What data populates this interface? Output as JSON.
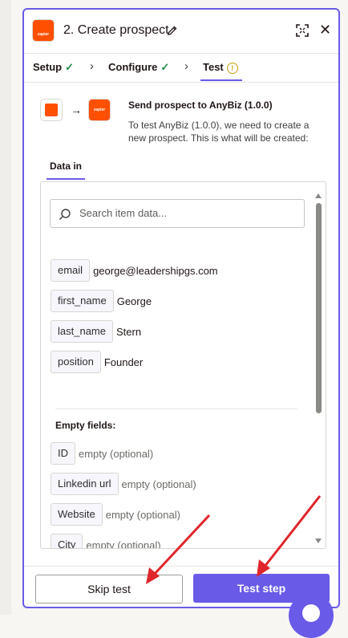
{
  "header": {
    "title": "2. Create prospect",
    "app_logo_text": "zapier"
  },
  "tabs": [
    {
      "label": "Setup",
      "status": "complete"
    },
    {
      "label": "Configure",
      "status": "complete"
    },
    {
      "label": "Test",
      "status": "warning",
      "active": true
    }
  ],
  "summary": {
    "title": "Send prospect to AnyBiz (1.0.0)",
    "description": "To test AnyBiz (1.0.0), we need to create a new prospect. This is what will be created:"
  },
  "data_in": {
    "tab_label": "Data in",
    "search_placeholder": "Search item data...",
    "fields": [
      {
        "key": "email",
        "value": "george@leadershipgs.com"
      },
      {
        "key": "first_name",
        "value": "George"
      },
      {
        "key": "last_name",
        "value": "Stern"
      },
      {
        "key": "position",
        "value": "Founder"
      }
    ],
    "empty_heading": "Empty fields:",
    "empty_fields": [
      {
        "key": "ID",
        "value": "empty (optional)"
      },
      {
        "key": "Linkedin url",
        "value": "empty (optional)"
      },
      {
        "key": "Website",
        "value": "empty (optional)"
      },
      {
        "key": "City",
        "value": "empty (optional)"
      }
    ]
  },
  "footer": {
    "skip_label": "Skip test",
    "test_label": "Test step"
  },
  "colors": {
    "accent": "#695be8",
    "brand": "#ff4f00",
    "success": "#1e8a4a",
    "warning": "#c8a20a"
  }
}
